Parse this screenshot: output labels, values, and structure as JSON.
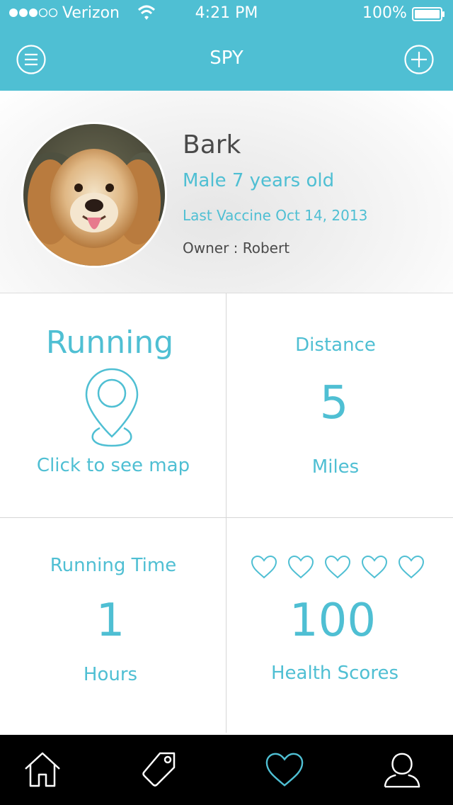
{
  "status_bar": {
    "carrier": "Verizon",
    "time": "4:21 PM",
    "battery": "100%"
  },
  "nav": {
    "title": "SPY",
    "left_icon": "menu-icon",
    "right_icon": "plus-icon"
  },
  "pet": {
    "name": "Bark",
    "info": "Male 7 years old",
    "vaccine": "Last Vaccine Oct 14, 2013",
    "owner": "Owner : Robert"
  },
  "stats": {
    "running": {
      "title": "Running",
      "icon": "location-pin-icon",
      "link": "Click to see map"
    },
    "distance": {
      "label": "Distance",
      "value": "5",
      "unit": "Miles"
    },
    "running_time": {
      "label": "Running Time",
      "value": "1",
      "unit": "Hours"
    },
    "health": {
      "rating": 5,
      "rating_max": 5,
      "value": "100",
      "label": "Health Scores"
    }
  },
  "tabbar": {
    "items": [
      "home-icon",
      "tag-icon",
      "heart-icon",
      "user-icon"
    ],
    "active": "heart-icon",
    "active_color": "#4fbfd3"
  },
  "colors": {
    "accent": "#4fbfd3",
    "text_dark": "#4a4a4a"
  }
}
